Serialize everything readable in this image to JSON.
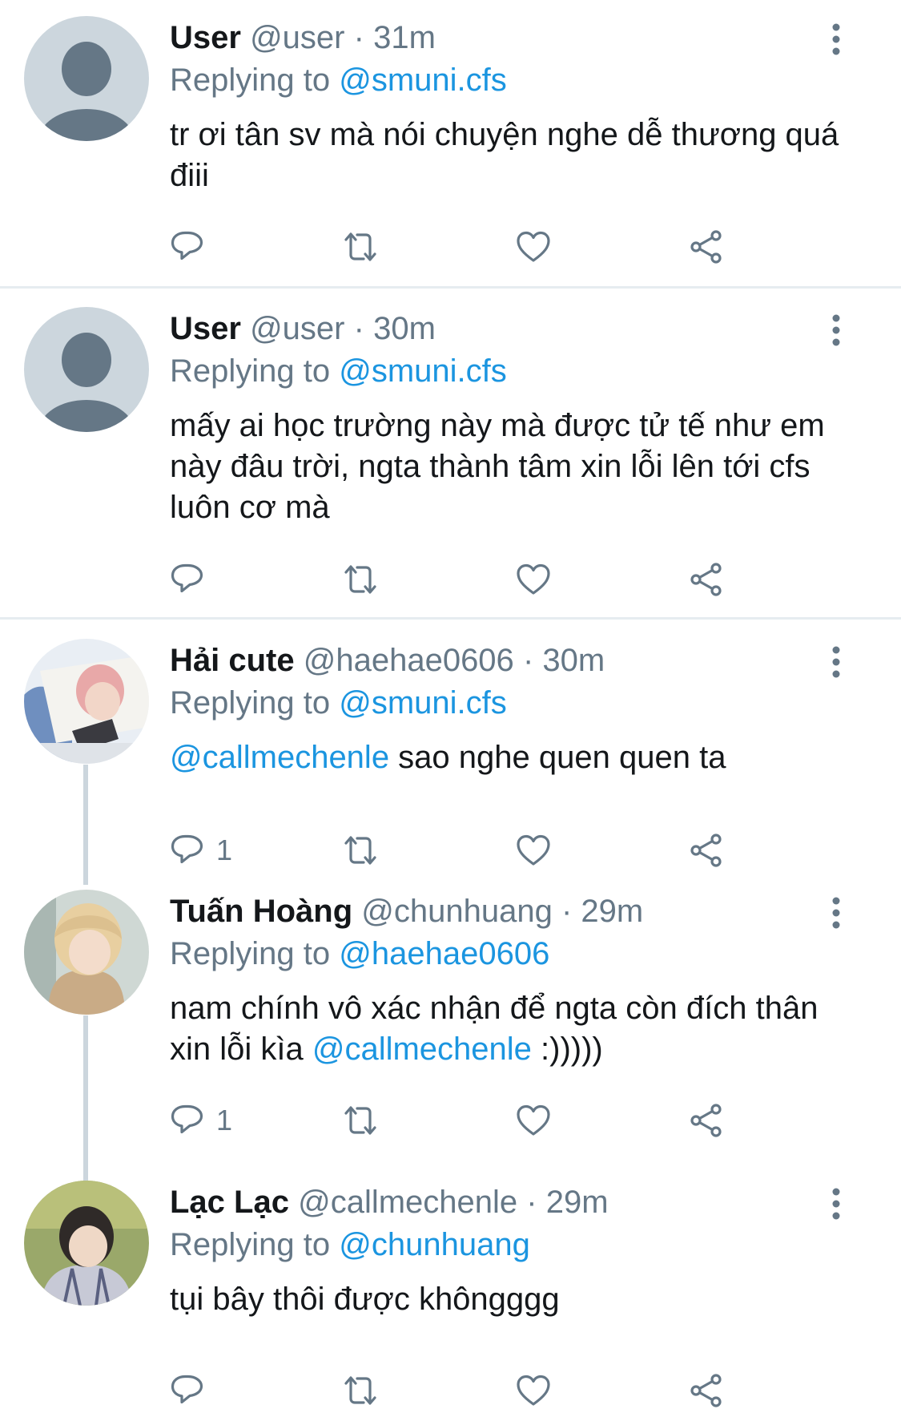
{
  "tweets": [
    {
      "name": "User",
      "handle": "@user",
      "sep": "·",
      "time": "31m",
      "replying_prefix": "Replying to",
      "replying_to": "@smuni.cfs",
      "text": "tr ơi tân sv mà nói chuyện nghe dễ thương quá điii",
      "reply_count": "",
      "avatar": "default-silhouette"
    },
    {
      "name": "User",
      "handle": "@user",
      "sep": "·",
      "time": "30m",
      "replying_prefix": "Replying to",
      "replying_to": "@smuni.cfs",
      "text": "mấy ai học trường này mà được tử tế như em này đâu trời, ngta thành tâm xin lỗi lên tới cfs luôn cơ mà",
      "reply_count": "",
      "avatar": "default-silhouette"
    },
    {
      "name": "Hải cute",
      "handle": "@haehae0606",
      "sep": "·",
      "time": "30m",
      "replying_prefix": "Replying to",
      "replying_to": "@smuni.cfs",
      "mention": "@callmechenle",
      "text": " sao nghe quen quen ta",
      "reply_count": "1",
      "avatar": "photo-pink-hair"
    },
    {
      "name": "Tuấn Hoàng",
      "handle": "@chunhuang",
      "sep": "·",
      "time": "29m",
      "replying_prefix": "Replying to",
      "replying_to": "@haehae0606",
      "text_before": "nam chính vô xác nhận để ngta còn đích thân xin lỗi kìa ",
      "mention": "@callmechenle",
      "text_after": " :)))))",
      "reply_count": "1",
      "avatar": "photo-blond-hair"
    },
    {
      "name": "Lạc Lạc",
      "handle": "@callmechenle",
      "sep": "·",
      "time": "29m",
      "replying_prefix": "Replying to",
      "replying_to": "@chunhuang",
      "text": "tụi bây thôi được khôngggg",
      "reply_count": "",
      "avatar": "photo-dark-hair"
    }
  ],
  "colors": {
    "link": "#1b95e0",
    "meta": "#657786",
    "separator": "#e6ecf0",
    "thread_line": "#ccd6dd"
  },
  "icons": [
    "reply-icon",
    "retweet-icon",
    "like-icon",
    "share-icon",
    "more-icon"
  ]
}
